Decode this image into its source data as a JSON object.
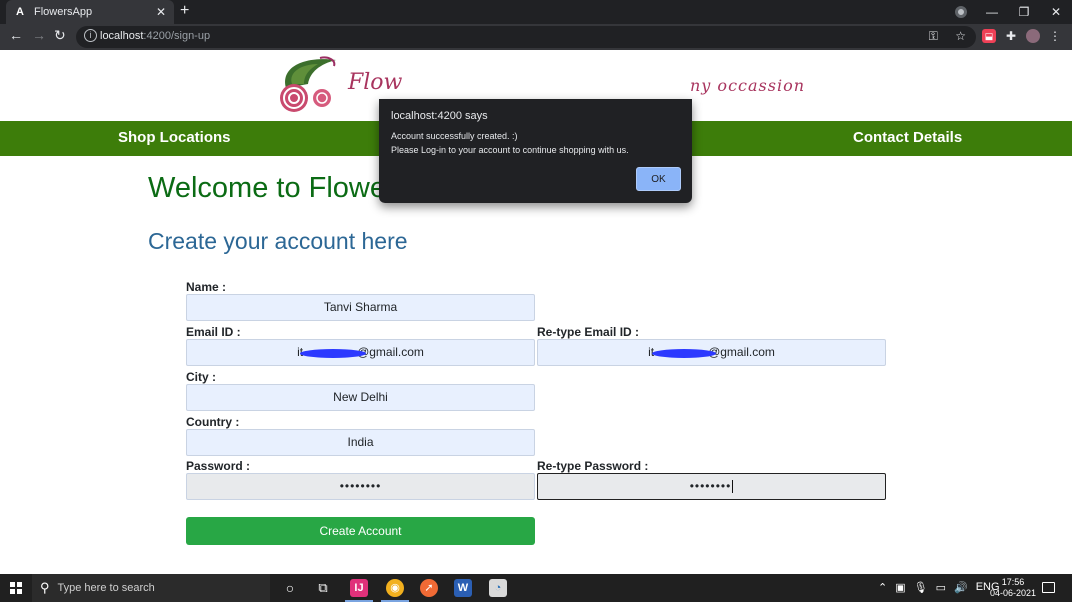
{
  "browser": {
    "tab_title": "FlowersApp",
    "tab_favicon": "A",
    "url_host": "localhost",
    "url_path": ":4200/sign-up"
  },
  "banner": {
    "logo_text": "Flow",
    "tagline": "ny occassion"
  },
  "navbar": {
    "shop_locations": "Shop Locations",
    "contact_details": "Contact Details"
  },
  "main": {
    "welcome": "Welcome to Flowers Online",
    "create_title": "Create your account here"
  },
  "form": {
    "name_label": "Name :",
    "name_value": "Tanvi Sharma",
    "email_label": "Email ID :",
    "email_value_prefix": "it",
    "email_value_suffix": "@gmail.com",
    "retype_email_label": "Re-type Email ID :",
    "retype_email_prefix": "it",
    "retype_email_suffix": "@gmail.com",
    "city_label": "City :",
    "city_value": "New Delhi",
    "country_label": "Country :",
    "country_value": "India",
    "password_label": "Password :",
    "password_value": "••••••••",
    "retype_password_label": "Re-type Password :",
    "retype_password_value": "••••••••",
    "submit_label": "Create Account"
  },
  "alert": {
    "title": "localhost:4200 says",
    "line1": "Account successfully created. :)",
    "line2": "Please Log-in to your account to continue shopping with us.",
    "ok_label": "OK"
  },
  "taskbar": {
    "search_placeholder": "Type here to search",
    "lang": "ENG",
    "time": "17:56",
    "date": "04-06-2021"
  },
  "colors": {
    "nav_green": "#3d7d0a",
    "welcome_green": "#0b6b14",
    "title_blue": "#2c6795",
    "button_green": "#28a745",
    "alert_ok_blue": "#8ab4f8"
  }
}
